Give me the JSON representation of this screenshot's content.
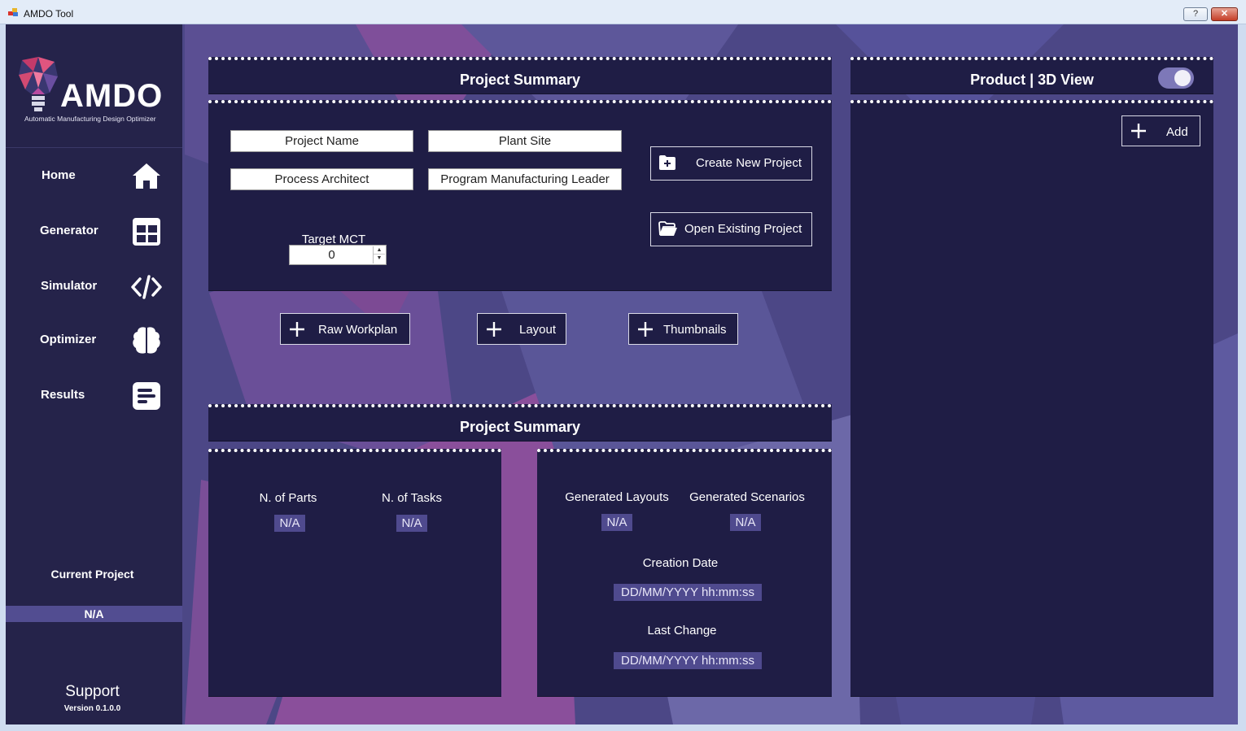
{
  "window": {
    "title": "AMDO Tool",
    "help_label": "?",
    "close_label": "✕"
  },
  "sidebar": {
    "logo": "AMDO",
    "logo_subtitle": "Automatic Manufacturing Design Optimizer",
    "items": [
      {
        "label": "Home",
        "icon": "home-icon"
      },
      {
        "label": "Generator",
        "icon": "grid-icon"
      },
      {
        "label": "Simulator",
        "icon": "code-icon"
      },
      {
        "label": "Optimizer",
        "icon": "brain-icon"
      },
      {
        "label": "Results",
        "icon": "document-icon"
      }
    ],
    "current_project_label": "Current Project",
    "current_project_value": "N/A",
    "support_label": "Support",
    "version": "Version 0.1.0.0"
  },
  "project": {
    "title": "Project Summary",
    "fields": {
      "project_name": "Project Name",
      "plant_site": "Plant Site",
      "process_architect": "Process Architect",
      "program_manufacturing_leader": "Program Manufacturing Leader"
    },
    "target_mct_label": "Target MCT",
    "target_mct_value": "0",
    "create_button": "Create New Project",
    "open_button": "Open Existing Project"
  },
  "add_buttons": {
    "raw_workplan": "Raw Workplan",
    "layout": "Layout",
    "thumbnails": "Thumbnails"
  },
  "summary": {
    "title": "Project Summary",
    "n_parts_label": "N. of Parts",
    "n_parts_value": "N/A",
    "n_tasks_label": "N. of Tasks",
    "n_tasks_value": "N/A",
    "generated_layouts_label": "Generated Layouts",
    "generated_layouts_value": "N/A",
    "generated_scenarios_label": "Generated Scenarios",
    "generated_scenarios_value": "N/A",
    "creation_date_label": "Creation Date",
    "creation_date_value": "DD/MM/YYYY  hh:mm:ss",
    "last_change_label": "Last Change",
    "last_change_value": "DD/MM/YYYY  hh:mm:ss"
  },
  "product": {
    "title": "Product | 3D View",
    "add_button": "Add",
    "toggle_on": true
  },
  "colors": {
    "sidebar": "#25234a",
    "panel": "#1f1d45",
    "background": "#4c4786",
    "accent": "#524d91"
  }
}
